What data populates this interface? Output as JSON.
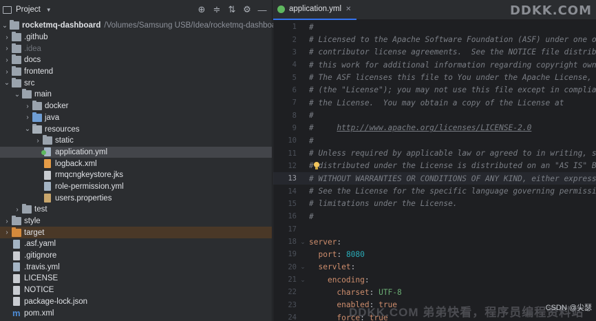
{
  "project_panel": {
    "title": "Project",
    "tools": [
      "target-icon",
      "collapse-icon",
      "expand-icon",
      "gear-icon",
      "minimize-icon"
    ]
  },
  "tree": {
    "root": {
      "name": "rocketmq-dashboard",
      "path": "/Volumes/Samsung USB/Idea/rocketmq-dashboard"
    },
    "items": [
      {
        "label": ".github",
        "depth": 1,
        "kind": "folder",
        "arrow": "›"
      },
      {
        "label": ".idea",
        "depth": 1,
        "kind": "folder",
        "arrow": "›",
        "dim": true
      },
      {
        "label": "docs",
        "depth": 1,
        "kind": "folder",
        "arrow": "›"
      },
      {
        "label": "frontend",
        "depth": 1,
        "kind": "folder",
        "arrow": "›"
      },
      {
        "label": "src",
        "depth": 1,
        "kind": "folder",
        "arrow": "⌄"
      },
      {
        "label": "main",
        "depth": 2,
        "kind": "folder",
        "arrow": "⌄"
      },
      {
        "label": "docker",
        "depth": 3,
        "kind": "folder",
        "arrow": "›"
      },
      {
        "label": "java",
        "depth": 3,
        "kind": "folder-blue",
        "arrow": "›"
      },
      {
        "label": "resources",
        "depth": 3,
        "kind": "folder-res",
        "arrow": "⌄"
      },
      {
        "label": "static",
        "depth": 4,
        "kind": "folder",
        "arrow": "›"
      },
      {
        "label": "application.yml",
        "depth": 4,
        "kind": "file-yml",
        "selected": true
      },
      {
        "label": "logback.xml",
        "depth": 4,
        "kind": "file-xml"
      },
      {
        "label": "rmqcngkeystore.jks",
        "depth": 4,
        "kind": "file"
      },
      {
        "label": "role-permission.yml",
        "depth": 4,
        "kind": "file-yml"
      },
      {
        "label": "users.properties",
        "depth": 4,
        "kind": "file-prop"
      },
      {
        "label": "test",
        "depth": 2,
        "kind": "folder",
        "arrow": "›"
      },
      {
        "label": "style",
        "depth": 1,
        "kind": "folder",
        "arrow": "›"
      },
      {
        "label": "target",
        "depth": 1,
        "kind": "folder-orange",
        "arrow": "›",
        "excluded": true
      },
      {
        "label": ".asf.yaml",
        "depth": 1,
        "kind": "file-yml"
      },
      {
        "label": ".gitignore",
        "depth": 1,
        "kind": "file"
      },
      {
        "label": ".travis.yml",
        "depth": 1,
        "kind": "file-yml"
      },
      {
        "label": "LICENSE",
        "depth": 1,
        "kind": "file"
      },
      {
        "label": "NOTICE",
        "depth": 1,
        "kind": "file"
      },
      {
        "label": "package-lock.json",
        "depth": 1,
        "kind": "file"
      },
      {
        "label": "pom.xml",
        "depth": 1,
        "kind": "file-m"
      }
    ]
  },
  "editor": {
    "tab_label": "application.yml",
    "watermark_top": "DDKK.COM",
    "watermark_bottom": "DDKK.COM 弟弟快看，程序员编程资料站",
    "csdn": "CSDN @尖瑟",
    "current_line": 13,
    "lines": [
      {
        "n": 1,
        "type": "comment",
        "text": "#"
      },
      {
        "n": 2,
        "type": "comment",
        "text": "# Licensed to the Apache Software Foundation (ASF) under one or"
      },
      {
        "n": 3,
        "type": "comment",
        "text": "# contributor license agreements.  See the NOTICE file distrib"
      },
      {
        "n": 4,
        "type": "comment",
        "text": "# this work for additional information regarding copyright owne"
      },
      {
        "n": 5,
        "type": "comment",
        "text": "# The ASF licenses this file to You under the Apache License, V"
      },
      {
        "n": 6,
        "type": "comment",
        "text": "# (the \"License\"); you may not use this file except in complian"
      },
      {
        "n": 7,
        "type": "comment",
        "text": "# the License.  You may obtain a copy of the License at"
      },
      {
        "n": 8,
        "type": "comment",
        "text": "#"
      },
      {
        "n": 9,
        "type": "link",
        "prefix": "#     ",
        "text": "http://www.apache.org/licenses/LICENSE-2.0"
      },
      {
        "n": 10,
        "type": "comment",
        "text": "#"
      },
      {
        "n": 11,
        "type": "comment",
        "text": "# Unless required by applicable law or agreed to in writing, so"
      },
      {
        "n": 12,
        "type": "comment",
        "text": "# distributed under the License is distributed on an \"AS IS\" BA",
        "bulb": true
      },
      {
        "n": 13,
        "type": "comment",
        "text": "# WITHOUT WARRANTIES OR CONDITIONS OF ANY KIND, either express o"
      },
      {
        "n": 14,
        "type": "comment",
        "text": "# See the License for the specific language governing permissio"
      },
      {
        "n": 15,
        "type": "comment",
        "text": "# limitations under the License."
      },
      {
        "n": 16,
        "type": "comment",
        "text": "#"
      },
      {
        "n": 17,
        "type": "blank",
        "text": ""
      },
      {
        "n": 18,
        "type": "key",
        "indent": 0,
        "key": "server",
        "fold": true
      },
      {
        "n": 19,
        "type": "kv",
        "indent": 1,
        "key": "port",
        "value": "8080",
        "vtype": "num"
      },
      {
        "n": 20,
        "type": "key",
        "indent": 1,
        "key": "servlet",
        "fold": true
      },
      {
        "n": 21,
        "type": "key",
        "indent": 2,
        "key": "encoding",
        "fold": true
      },
      {
        "n": 22,
        "type": "kv",
        "indent": 3,
        "key": "charset",
        "value": "UTF-8",
        "vtype": "str"
      },
      {
        "n": 23,
        "type": "kv",
        "indent": 3,
        "key": "enabled",
        "value": "true",
        "vtype": "bool"
      },
      {
        "n": 24,
        "type": "kv",
        "indent": 3,
        "key": "force",
        "value": "true",
        "vtype": "bool"
      }
    ]
  }
}
